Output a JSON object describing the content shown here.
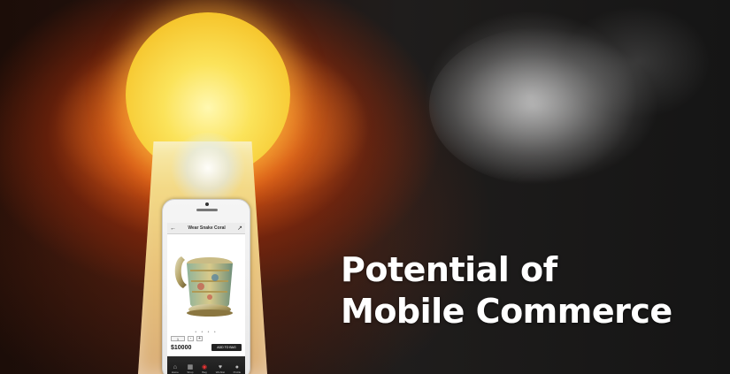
{
  "headline": {
    "line1": "Potential of",
    "line2": "Mobile Commerce"
  },
  "phone": {
    "app_title": "Wear Snake Coral",
    "back_icon": "back-arrow-icon",
    "share_icon": "share-icon",
    "product_image": "russian-tea-glass-holder",
    "carousel_dots": "• • • •",
    "quantity_label": "1",
    "quantity_minus": "-",
    "quantity_plus": "+",
    "price": "$10000",
    "add_to_bag_label": "ADD TO BAG",
    "tabs": [
      {
        "icon": "home-icon",
        "label": "Home",
        "glyph": "⌂"
      },
      {
        "icon": "shop-grid-icon",
        "label": "Shop",
        "glyph": "▦"
      },
      {
        "icon": "bag-icon",
        "label": "Bag",
        "glyph": "◉"
      },
      {
        "icon": "heart-icon",
        "label": "Wishlist",
        "glyph": "♥"
      },
      {
        "icon": "profile-icon",
        "label": "Profile",
        "glyph": "●"
      }
    ]
  },
  "colors": {
    "keyhole_light": "#fbe35a",
    "headline_text": "#ffffff"
  }
}
